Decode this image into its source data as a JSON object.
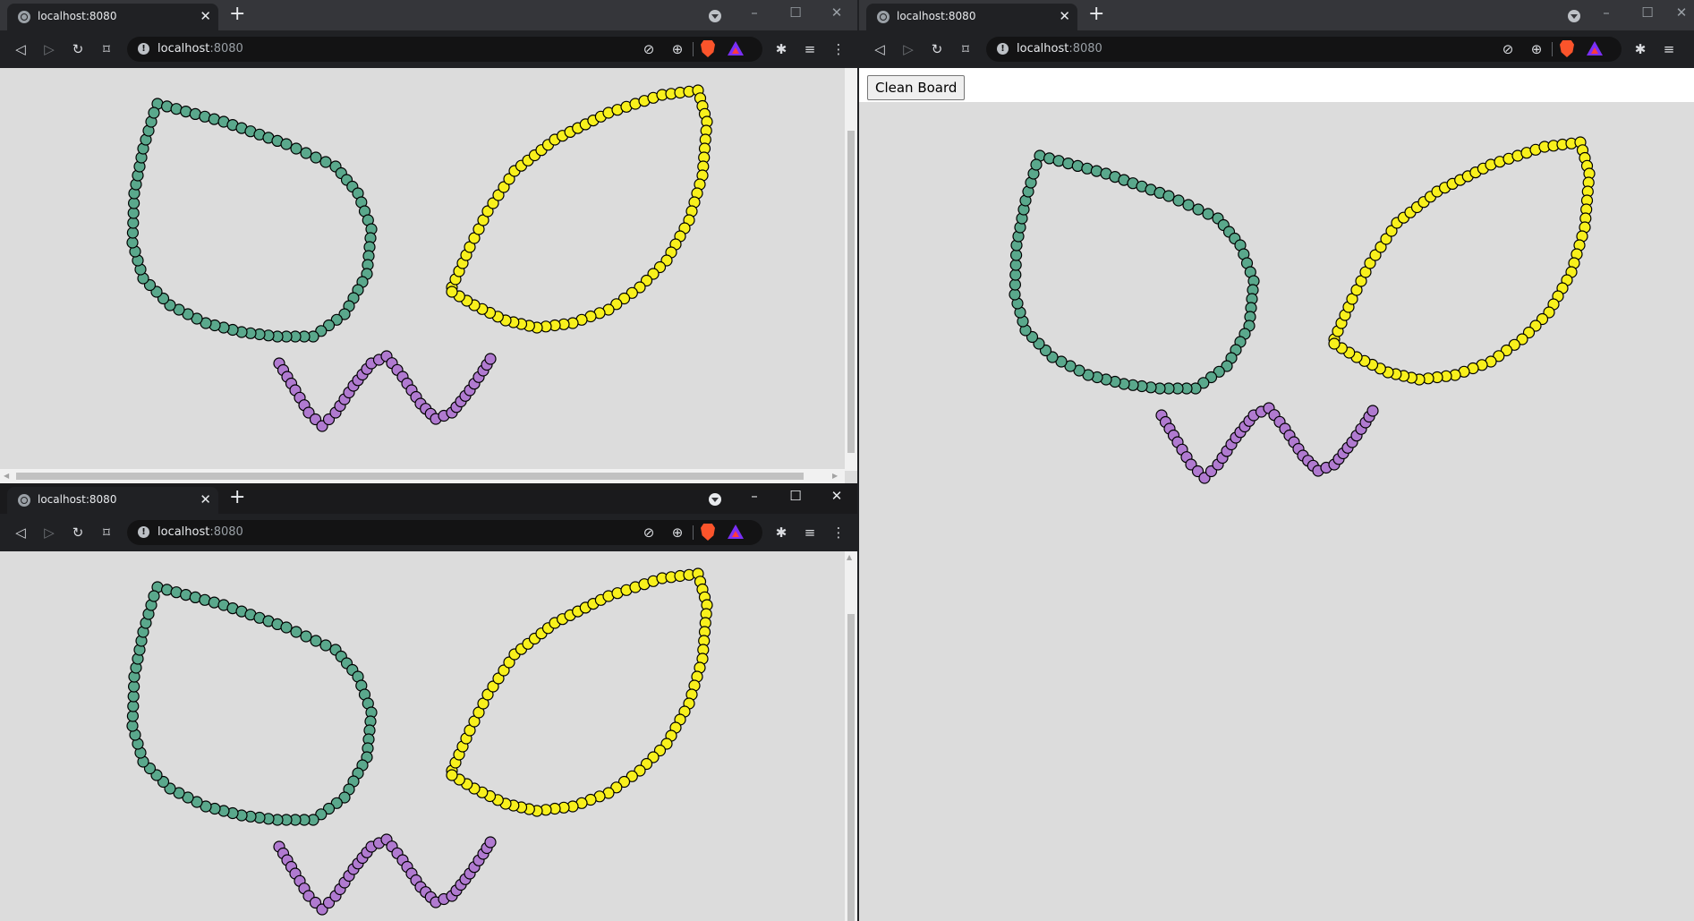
{
  "windows": [
    {
      "id": "top-left",
      "tab_title": "localhost:8080",
      "url_host": "localhost",
      "url_port": ":8080",
      "has_button": false,
      "active": false
    },
    {
      "id": "bottom-left",
      "tab_title": "localhost:8080",
      "url_host": "localhost",
      "url_port": ":8080",
      "has_button": false,
      "active": true
    },
    {
      "id": "right",
      "tab_title": "localhost:8080",
      "url_host": "localhost",
      "url_port": ":8080",
      "has_button": true,
      "active": false
    }
  ],
  "clean_button_label": "Clean Board",
  "colors": {
    "canvas_bg": "#dcdcdc",
    "green": "#5aa88c",
    "yellow": "#f8f01c",
    "purple": "#b07ad0",
    "outline": "#000000"
  },
  "icons": [
    "back-icon",
    "forward-icon",
    "reload-icon",
    "bookmark-icon",
    "site-info-icon",
    "cast-icon",
    "zoom-icon",
    "brave-shield-icon",
    "brave-rewards-icon",
    "extensions-icon",
    "media-icon",
    "menu-icon",
    "tab-search-icon",
    "minimize-icon",
    "maximize-icon",
    "close-icon",
    "new-tab-icon"
  ]
}
